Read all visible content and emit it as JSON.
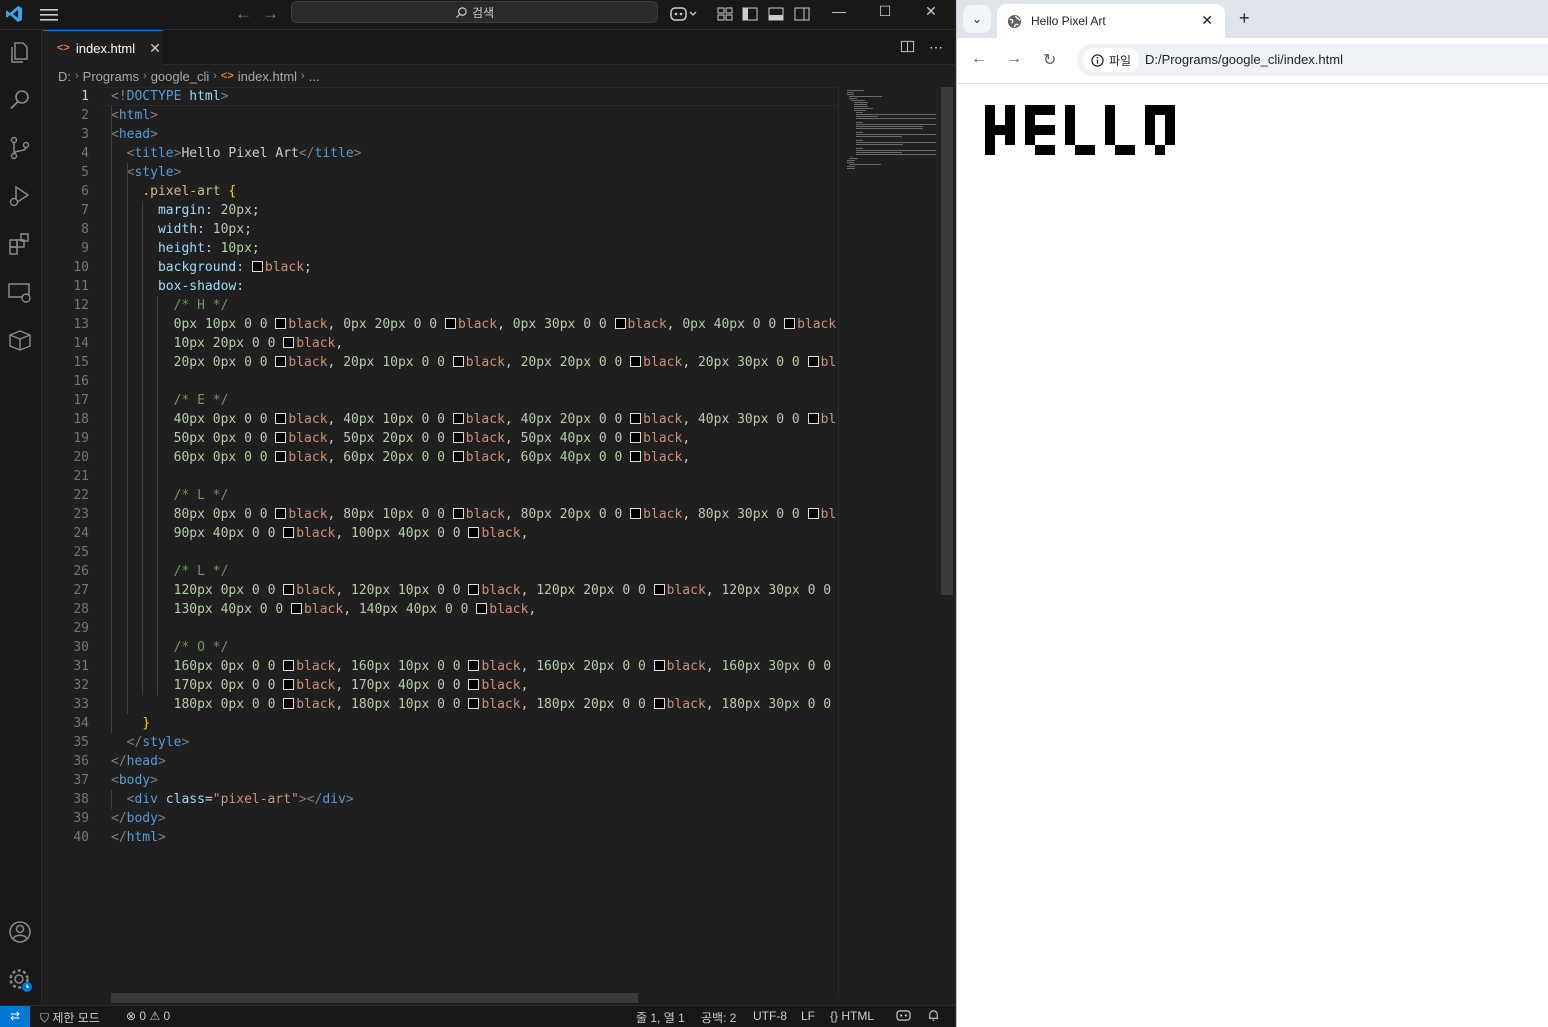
{
  "vscode": {
    "search_label": "검색",
    "tab": {
      "label": "index.html",
      "file_icon": "<>"
    },
    "breadcrumb": [
      "D:",
      "Programs",
      "google_cli",
      "index.html",
      "..."
    ],
    "breadcrumb_file_icon": "<>",
    "status": {
      "restricted": "제한 모드",
      "errors": "0",
      "warnings": "0",
      "position": "줄 1, 열 1",
      "indent": "공백: 2",
      "encoding": "UTF-8",
      "eol": "LF",
      "language": "HTML"
    },
    "code_lines": [
      "<!DOCTYPE html>",
      "<html>",
      "<head>",
      "  <title>Hello Pixel Art</title>",
      "  <style>",
      "    .pixel-art {",
      "      margin: 20px;",
      "      width: 10px;",
      "      height: 10px;",
      "      background: black;",
      "      box-shadow:",
      "        /* H */",
      "        0px 10px 0 0 black, 0px 20px 0 0 black, 0px 30px 0 0 black, 0px 40px 0 0 black",
      "        10px 20px 0 0 black,",
      "        20px 0px 0 0 black, 20px 10px 0 0 black, 20px 20px 0 0 black, 20px 30px 0 0 bl",
      "",
      "        /* E */",
      "        40px 0px 0 0 black, 40px 10px 0 0 black, 40px 20px 0 0 black, 40px 30px 0 0 bl",
      "        50px 0px 0 0 black, 50px 20px 0 0 black, 50px 40px 0 0 black,",
      "        60px 0px 0 0 black, 60px 20px 0 0 black, 60px 40px 0 0 black,",
      "",
      "        /* L */",
      "        80px 0px 0 0 black, 80px 10px 0 0 black, 80px 20px 0 0 black, 80px 30px 0 0 bl",
      "        90px 40px 0 0 black, 100px 40px 0 0 black,",
      "",
      "        /* L */",
      "        120px 0px 0 0 black, 120px 10px 0 0 black, 120px 20px 0 0 black, 120px 30px 0 0",
      "        130px 40px 0 0 black, 140px 40px 0 0 black,",
      "",
      "        /* O */",
      "        160px 0px 0 0 black, 160px 10px 0 0 black, 160px 20px 0 0 black, 160px 30px 0 0",
      "        170px 0px 0 0 black, 170px 40px 0 0 black,",
      "        180px 0px 0 0 black, 180px 10px 0 0 black, 180px 20px 0 0 black, 180px 30px 0 0",
      "    }",
      "  </style>",
      "</head>",
      "<body>",
      "  <div class=\"pixel-art\"></div>",
      "</body>",
      "</html>"
    ],
    "current_line": 1
  },
  "chrome": {
    "tab_title": "Hello Pixel Art",
    "site_chip": "파일",
    "url": "D:/Programs/google_cli/index.html",
    "page_heading": "HELLO"
  },
  "colors": {
    "vscode_bg": "#1f1f1f",
    "accent": "#0078d4",
    "tag": "#569cd6",
    "prop": "#9cdcfe",
    "number": "#b5cea8",
    "value": "#ce9178",
    "comment": "#6a9955",
    "selector": "#d7ba7d"
  }
}
